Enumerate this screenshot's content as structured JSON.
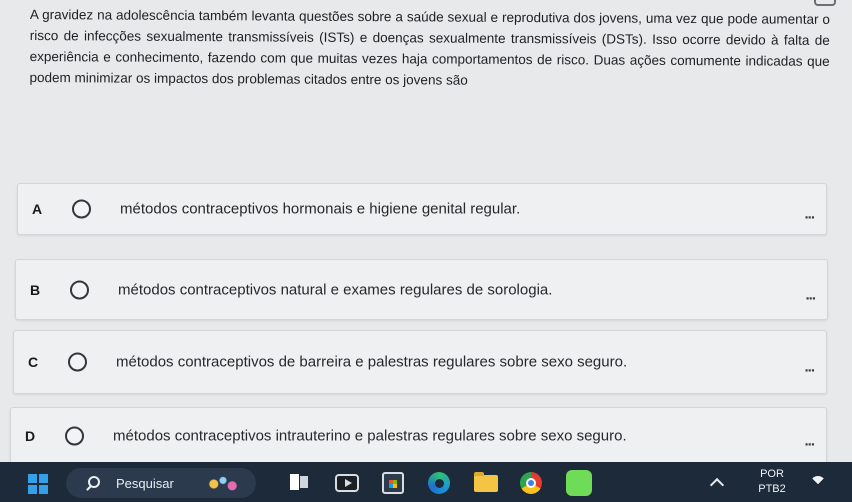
{
  "question": {
    "text": "A gravidez na adolescência também levanta questões sobre a saúde sexual e reprodutiva dos jovens, uma vez que pode aumentar o risco de infecções sexualmente transmissíveis (ISTs) e doenças sexualmente transmissíveis (DSTs). Isso ocorre devido à falta de experiência e conhecimento, fazendo com que muitas vezes haja comportamentos de risco. Duas ações comumente indicadas que podem minimizar os impactos dos problemas citados entre os jovens são"
  },
  "options": [
    {
      "letter": "A",
      "text": "métodos contraceptivos hormonais e higiene genital regular.",
      "more": "..."
    },
    {
      "letter": "B",
      "text": "métodos contraceptivos natural e exames regulares de sorologia.",
      "more": "..."
    },
    {
      "letter": "C",
      "text": "métodos contraceptivos de barreira e palestras regulares sobre sexo seguro.",
      "more": "..."
    },
    {
      "letter": "D",
      "text": "métodos contraceptivos intrauterino e palestras regulares sobre sexo seguro.",
      "more": "..."
    }
  ],
  "taskbar": {
    "search_placeholder": "Pesquisar",
    "language_line1": "POR",
    "language_line2": "PTB2",
    "icons": [
      "windows-start-icon",
      "search-icon",
      "task-view-icon",
      "video-app-icon",
      "store-icon",
      "edge-icon",
      "file-explorer-icon",
      "chrome-icon",
      "app-icon",
      "chevron-up-icon",
      "wifi-icon"
    ]
  }
}
